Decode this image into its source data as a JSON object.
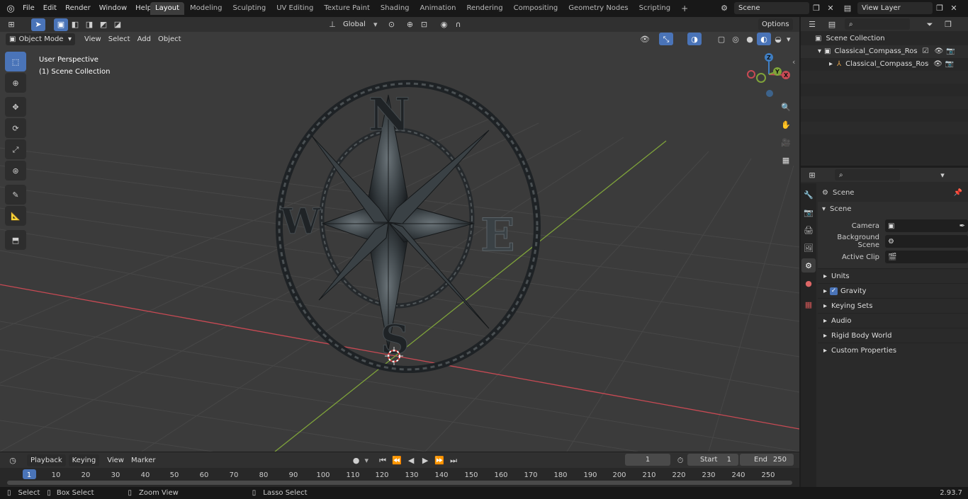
{
  "menu": {
    "file": "File",
    "edit": "Edit",
    "render": "Render",
    "window": "Window",
    "help": "Help"
  },
  "workspaces": [
    "Layout",
    "Modeling",
    "Sculpting",
    "UV Editing",
    "Texture Paint",
    "Shading",
    "Animation",
    "Rendering",
    "Compositing",
    "Geometry Nodes",
    "Scripting"
  ],
  "top_right": {
    "scene": "Scene",
    "view_layer": "View Layer"
  },
  "viewport": {
    "mode": "Object Mode",
    "view": "View",
    "select": "Select",
    "add": "Add",
    "object": "Object",
    "transform_orientation": "Global",
    "options": "Options",
    "overlay_title": "User Perspective",
    "overlay_subtitle": "(1) Scene Collection",
    "compass_letters": {
      "n": "N",
      "s": "S",
      "e": "E",
      "w": "W"
    },
    "gizmo_axes": {
      "x": "X",
      "y": "Y",
      "z": "Z"
    }
  },
  "outliner": {
    "root": "Scene Collection",
    "items": [
      {
        "label": "Classical_Compass_Rose_Ste"
      },
      {
        "label": "Classical_Compass_Rose"
      }
    ]
  },
  "properties": {
    "header": "Scene",
    "section": "Scene",
    "fields": [
      {
        "label": "Camera"
      },
      {
        "label": "Background Scene"
      },
      {
        "label": "Active Clip"
      }
    ],
    "panels": [
      "Units",
      "Gravity",
      "Keying Sets",
      "Audio",
      "Rigid Body World",
      "Custom Properties"
    ]
  },
  "timeline": {
    "playback": "Playback",
    "keying": "Keying",
    "view": "View",
    "marker": "Marker",
    "current_frame": "1",
    "start_label": "Start",
    "start": "1",
    "end_label": "End",
    "end": "250",
    "ticks": [
      "1",
      "10",
      "20",
      "30",
      "40",
      "50",
      "60",
      "70",
      "80",
      "90",
      "100",
      "110",
      "120",
      "130",
      "140",
      "150",
      "160",
      "170",
      "180",
      "190",
      "200",
      "210",
      "220",
      "230",
      "240",
      "250"
    ]
  },
  "status": {
    "select": "Select",
    "box_select": "Box Select",
    "zoom_view": "Zoom View",
    "lasso_select": "Lasso Select",
    "version": "2.93.7"
  },
  "colors": {
    "accent": "#4a74b8",
    "x_axis": "#c94a54",
    "y_axis": "#7fa33a",
    "z_axis": "#3f7ec2"
  }
}
